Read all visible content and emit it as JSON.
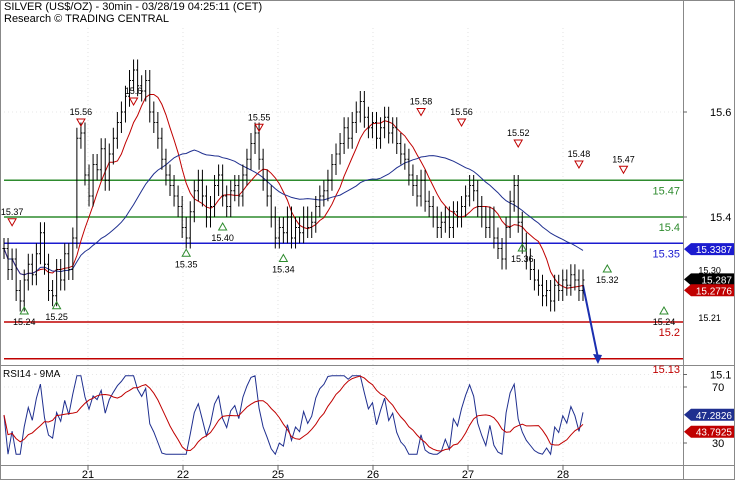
{
  "header": {
    "title": "SILVER (US$/OZ) - 30min - 03/28/19 04:25:11 (CET)",
    "credit": "Research © TRADING CENTRAL"
  },
  "colors": {
    "price": "#000000",
    "ma_fast": "#c00000",
    "ma_slow": "#1f2f8f",
    "resistance": "#2e8b2e",
    "pivot": "#1b1bcf",
    "support": "#c00000",
    "forecast_arrow": "#1b2fb0",
    "up_marker": "#2e8b2e",
    "down_marker": "#c00000"
  },
  "chart_data": [
    {
      "type": "line",
      "name": "price-panel",
      "x_ticks": [
        "21",
        "22",
        "25",
        "26",
        "27",
        "28"
      ],
      "y_ticks": [
        "15.6",
        "15.4",
        "15.1"
      ],
      "ylim": [
        15.12,
        15.76
      ],
      "price_series": [
        15.34,
        15.3,
        15.32,
        15.26,
        15.24,
        15.28,
        15.31,
        15.29,
        15.33,
        15.37,
        15.31,
        15.26,
        15.25,
        15.3,
        15.28,
        15.33,
        15.3,
        15.36,
        15.55,
        15.56,
        15.48,
        15.44,
        15.5,
        15.49,
        15.53,
        15.47,
        15.52,
        15.55,
        15.58,
        15.6,
        15.63,
        15.66,
        15.68,
        15.65,
        15.64,
        15.66,
        15.6,
        15.58,
        15.55,
        15.51,
        15.48,
        15.46,
        15.44,
        15.42,
        15.38,
        15.36,
        15.41,
        15.45,
        15.47,
        15.44,
        15.4,
        15.42,
        15.46,
        15.48,
        15.44,
        15.42,
        15.45,
        15.46,
        15.44,
        15.48,
        15.51,
        15.54,
        15.56,
        15.51,
        15.47,
        15.44,
        15.4,
        15.36,
        15.38,
        15.37,
        15.4,
        15.36,
        15.38,
        15.37,
        15.4,
        15.38,
        15.39,
        15.42,
        15.44,
        15.45,
        15.47,
        15.5,
        15.52,
        15.54,
        15.57,
        15.55,
        15.58,
        15.6,
        15.62,
        15.59,
        15.57,
        15.58,
        15.55,
        15.57,
        15.59,
        15.56,
        15.57,
        15.54,
        15.52,
        15.51,
        15.48,
        15.46,
        15.44,
        15.47,
        15.43,
        15.42,
        15.4,
        15.38,
        15.39,
        15.4,
        15.38,
        15.41,
        15.4,
        15.42,
        15.44,
        15.46,
        15.45,
        15.42,
        15.4,
        15.38,
        15.4,
        15.36,
        15.34,
        15.32,
        15.38,
        15.43,
        15.46,
        15.39,
        15.35,
        15.32,
        15.3,
        15.28,
        15.27,
        15.25,
        15.26,
        15.24,
        15.27,
        15.26,
        15.28,
        15.27,
        15.29,
        15.28,
        15.26,
        15.28
      ],
      "moving_averages": [
        {
          "label": "ma_fast",
          "period": 9
        },
        {
          "label": "ma_slow",
          "period": 30
        }
      ],
      "horizontal_levels": [
        {
          "value": 15.47,
          "label": "15.47",
          "kind": "resistance"
        },
        {
          "value": 15.4,
          "label": "15.4",
          "kind": "resistance"
        },
        {
          "value": 15.35,
          "label": "15.35",
          "kind": "pivot"
        },
        {
          "value": 15.2,
          "label": "15.2",
          "kind": "support"
        },
        {
          "value": 15.13,
          "label": "15.13",
          "kind": "support"
        }
      ],
      "price_tags": [
        {
          "value": 15.3387,
          "label": "15.3387",
          "kind": "pivot"
        },
        {
          "value": 15.287,
          "label": "15.287",
          "kind": "last"
        },
        {
          "value": 15.2776,
          "label": "15.2776",
          "kind": "support"
        }
      ],
      "swing_markers": [
        {
          "bar": 2,
          "value": 15.37,
          "label": "15.37",
          "dir": "down"
        },
        {
          "bar": 5,
          "value": 15.24,
          "label": "15.24",
          "dir": "up"
        },
        {
          "bar": 13,
          "value": 15.25,
          "label": "15.25",
          "dir": "up"
        },
        {
          "bar": 19,
          "value": 15.56,
          "label": "15.56",
          "dir": "down"
        },
        {
          "bar": 32,
          "value": 15.6,
          "label": "15.6",
          "dir": "down"
        },
        {
          "bar": 45,
          "value": 15.35,
          "label": "15.35",
          "dir": "up"
        },
        {
          "bar": 54,
          "value": 15.4,
          "label": "15.40",
          "dir": "up"
        },
        {
          "bar": 63,
          "value": 15.55,
          "label": "15.55",
          "dir": "down"
        },
        {
          "bar": 69,
          "value": 15.34,
          "label": "15.34",
          "dir": "up"
        },
        {
          "bar": 103,
          "value": 15.58,
          "label": "15.58",
          "dir": "down"
        },
        {
          "bar": 113,
          "value": 15.56,
          "label": "15.56",
          "dir": "down"
        },
        {
          "bar": 127,
          "value": 15.52,
          "label": "15.52",
          "dir": "down"
        },
        {
          "bar": 128,
          "value": 15.36,
          "label": "15.36",
          "dir": "up"
        },
        {
          "bar": 142,
          "value": 15.48,
          "label": "15.48",
          "dir": "down"
        },
        {
          "bar": 149,
          "value": 15.32,
          "label": "15.32",
          "dir": "up"
        },
        {
          "bar": 153,
          "value": 15.47,
          "label": "15.47",
          "dir": "down"
        },
        {
          "bar": 163,
          "value": 15.24,
          "label": "15.24",
          "dir": "up"
        }
      ],
      "annotations": [
        {
          "label": "15.30",
          "value": 15.3,
          "bar": 171
        },
        {
          "label": "15.21",
          "value": 15.21,
          "bar": 171
        }
      ]
    },
    {
      "type": "line",
      "name": "RSI14 - 9MA",
      "title": "RSI14 - 9MA",
      "y_ticks": [
        "70",
        "30"
      ],
      "ylim": [
        15,
        85
      ],
      "last_values": [
        {
          "label": "47.2826",
          "value": 47.28,
          "kind": "rsi"
        },
        {
          "label": "43.7925",
          "value": 43.79,
          "kind": "ma"
        }
      ]
    }
  ]
}
